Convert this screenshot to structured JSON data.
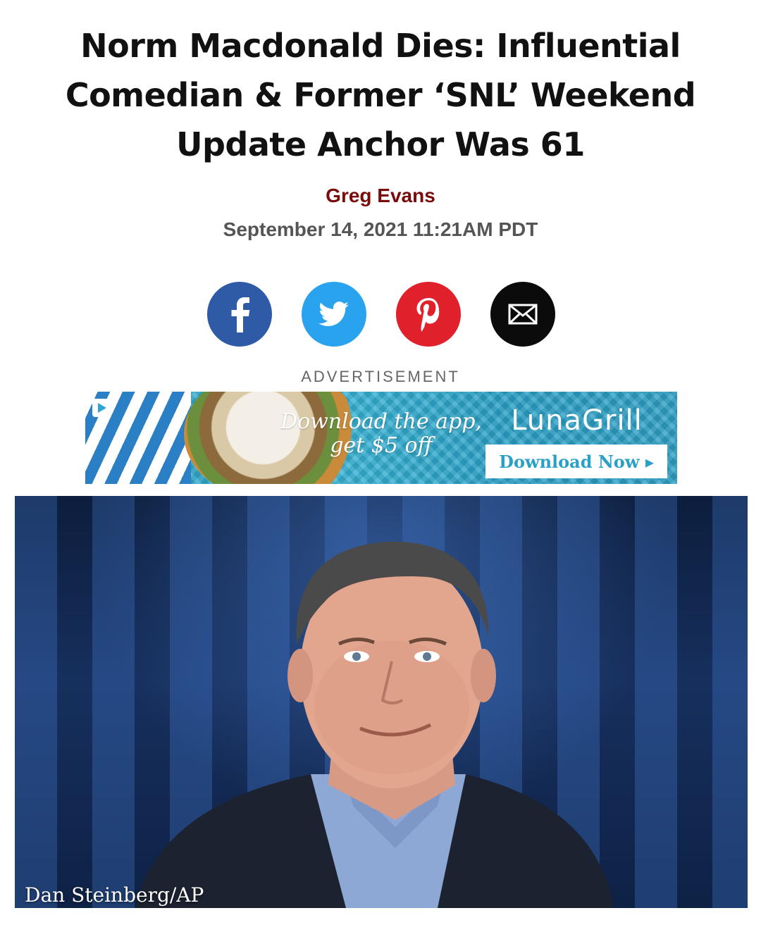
{
  "article": {
    "headline": "Norm Macdonald Dies: Influential Comedian & Former ‘SNL’ Weekend Update Anchor Was 61",
    "author": "Greg Evans",
    "date": "September 14, 2021 11:21AM PDT"
  },
  "share": {
    "buttons": [
      {
        "network": "facebook",
        "icon": "facebook-icon",
        "color": "#2f5aa6"
      },
      {
        "network": "twitter",
        "icon": "twitter-icon",
        "color": "#2aa3ee"
      },
      {
        "network": "pinterest",
        "icon": "pinterest-icon",
        "color": "#e0202b"
      },
      {
        "network": "email",
        "icon": "envelope-icon",
        "color": "#0b0b0b"
      }
    ]
  },
  "ad": {
    "label": "ADVERTISEMENT",
    "tagline_line1": "Download the app,",
    "tagline_line2": "get $5 off",
    "brand": "LunaGrill",
    "cta": "Download Now ▸",
    "accent_color": "#2aa0c6"
  },
  "photo": {
    "credit": "Dan Steinberg/AP"
  }
}
